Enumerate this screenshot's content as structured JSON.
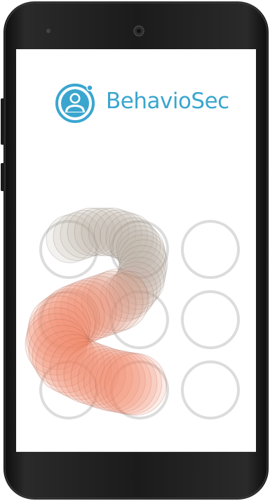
{
  "brand": {
    "name": "BehavioSec",
    "logo_icon": "user-shield-icon",
    "brand_color": "#3aa6cf"
  },
  "device": {
    "body_color": "#151515",
    "screen_color": "#ffffff"
  },
  "pattern_lock": {
    "grid_rows": 3,
    "grid_cols": 3,
    "node_ring_color": "#dcdcdc",
    "trail_colors": [
      "#b8aca0",
      "#f2866a"
    ]
  }
}
